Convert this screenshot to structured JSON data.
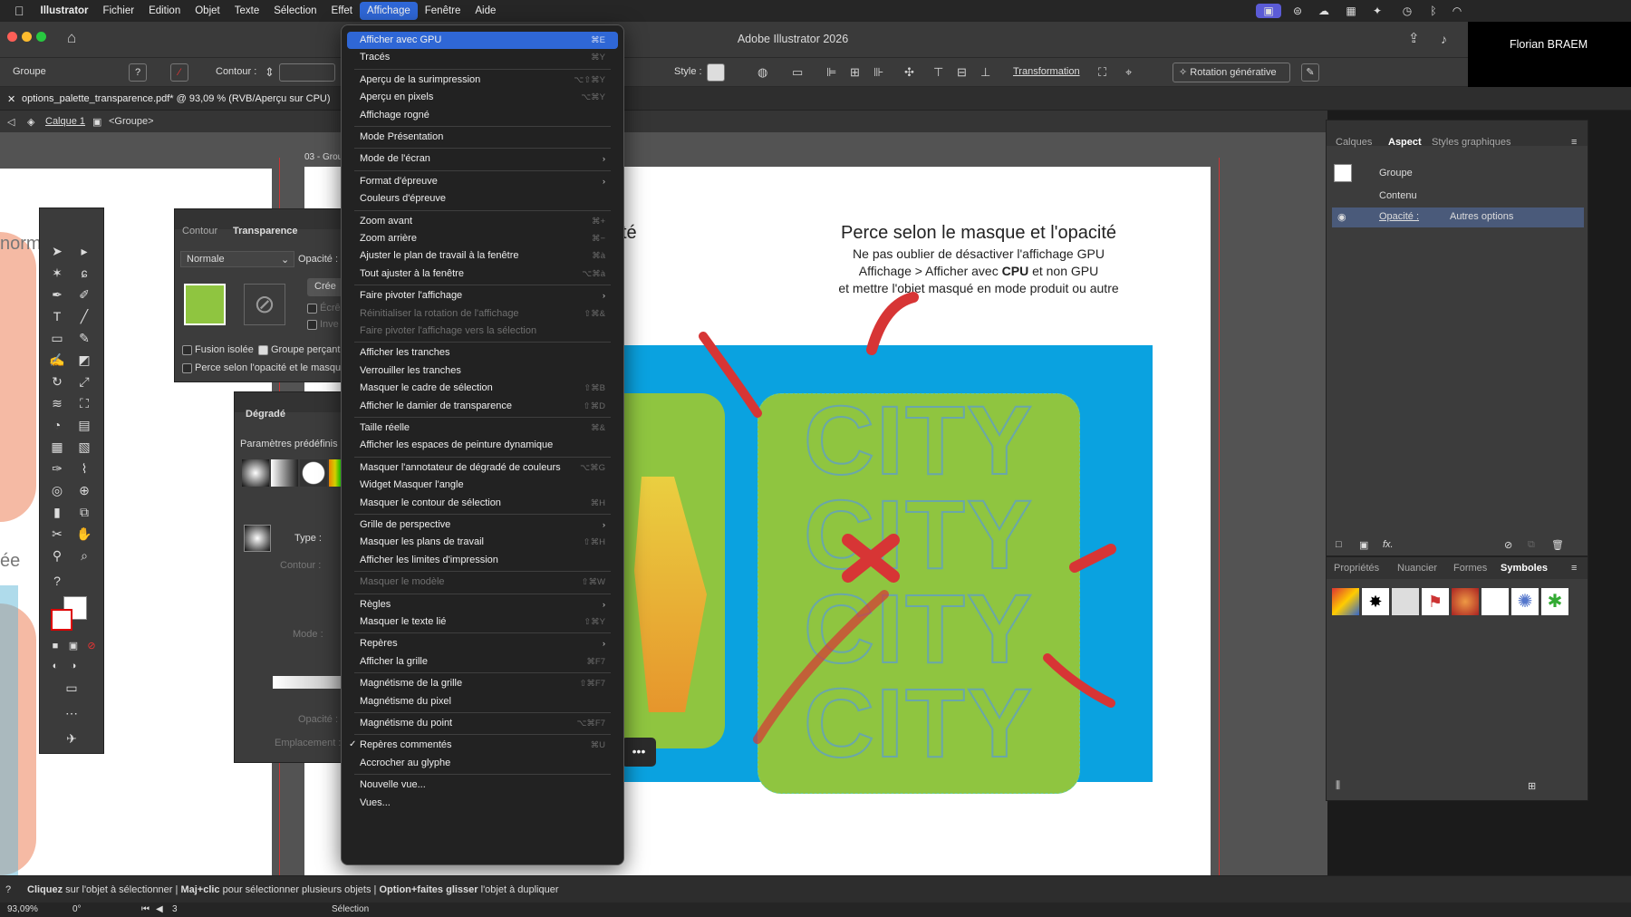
{
  "menubar": {
    "app": "Illustrator",
    "items": [
      "Fichier",
      "Edition",
      "Objet",
      "Texte",
      "Sélection",
      "Effet",
      "Affichage",
      "Fenêtre",
      "Aide"
    ],
    "active": "Affichage"
  },
  "window": {
    "title": "Adobe Illustrator 2026",
    "user": "Florian BRAEM"
  },
  "control": {
    "selection": "Groupe",
    "stroke_label": "Contour :",
    "style_label": "Style :",
    "transform": "Transformation",
    "generative": "Rotation générative"
  },
  "document": {
    "tab": "options_palette_transparence.pdf* @ 93,09 % (RVB/Aperçu sur CPU)",
    "layer": "Calque 1",
    "group": "<Groupe>",
    "artboard_label": "03 - Grou"
  },
  "artwork": {
    "heading": "Perce selon le masque et l'opacité",
    "line1": "Ne pas oublier de désactiver l'affichage GPU",
    "line2_a": "Affichage > Afficher avec ",
    "line2_b": "CPU",
    "line2_c": " et non GPU",
    "line3": "et mettre l'objet masqué en mode produit ou autre",
    "left_partial": "té",
    "word": "CITY",
    "colors": {
      "blue": "#0aa2e0",
      "green": "#8fc540",
      "red": "#d73535"
    }
  },
  "left_text": {
    "a": "norm",
    "b": "ée"
  },
  "transparency": {
    "tab1": "Contour",
    "tab2": "Transparence",
    "blend": "Normale",
    "opacity_label": "Opacité :",
    "create": "Crée",
    "clip": "Écrê",
    "invert": "Inve",
    "isolate": "Fusion isolée",
    "knockout": "Groupe perçant",
    "knockout_opacity": "Perce selon l'opacité et le masqu"
  },
  "gradient": {
    "title": "Dégradé",
    "presets": "Paramètres prédéfinis :",
    "type": "Type :",
    "stroke": "Contour :",
    "mode": "Mode :",
    "opacity": "Opacité :",
    "location": "Emplacement :"
  },
  "appearance": {
    "tabs": [
      "Calques",
      "Aspect",
      "Styles graphiques"
    ],
    "active": "Aspect",
    "group": "Groupe",
    "content": "Contenu",
    "opacity": "Opacité :",
    "other": "Autres options"
  },
  "symbols": {
    "tabs": [
      "Propriétés",
      "Nuancier",
      "Formes",
      "Symboles"
    ],
    "active": "Symboles"
  },
  "menu": [
    {
      "label": "Afficher avec GPU",
      "key": "⌘E",
      "hl": true
    },
    {
      "label": "Tracés",
      "key": "⌘Y"
    },
    {
      "sep": true
    },
    {
      "label": "Aperçu de la surimpression",
      "key": "⌥⇧⌘Y"
    },
    {
      "label": "Aperçu en pixels",
      "key": "⌥⌘Y"
    },
    {
      "label": "Affichage rogné"
    },
    {
      "sep": true
    },
    {
      "label": "Mode Présentation"
    },
    {
      "sep": true
    },
    {
      "label": "Mode de l'écran",
      "sub": true
    },
    {
      "sep": true
    },
    {
      "label": "Format d'épreuve",
      "sub": true
    },
    {
      "label": "Couleurs d'épreuve"
    },
    {
      "sep": true
    },
    {
      "label": "Zoom avant",
      "key": "⌘+"
    },
    {
      "label": "Zoom arrière",
      "key": "⌘−"
    },
    {
      "label": "Ajuster le plan de travail à la fenêtre",
      "key": "⌘à"
    },
    {
      "label": "Tout ajuster à la fenêtre",
      "key": "⌥⌘à"
    },
    {
      "sep": true
    },
    {
      "label": "Faire pivoter l'affichage",
      "sub": true
    },
    {
      "label": "Réinitialiser la rotation de l'affichage",
      "key": "⇧⌘&",
      "dis": true
    },
    {
      "label": "Faire pivoter l'affichage vers la sélection",
      "dis": true
    },
    {
      "sep": true
    },
    {
      "label": "Afficher les tranches"
    },
    {
      "label": "Verrouiller les tranches"
    },
    {
      "label": "Masquer le cadre de sélection",
      "key": "⇧⌘B"
    },
    {
      "label": "Afficher le damier de transparence",
      "key": "⇧⌘D"
    },
    {
      "sep": true
    },
    {
      "label": "Taille réelle",
      "key": "⌘&"
    },
    {
      "label": "Afficher les espaces de peinture dynamique"
    },
    {
      "sep": true
    },
    {
      "label": "Masquer l'annotateur de dégradé de couleurs",
      "key": "⌥⌘G"
    },
    {
      "label": "Widget Masquer l'angle"
    },
    {
      "label": "Masquer le contour de sélection",
      "key": "⌘H"
    },
    {
      "sep": true
    },
    {
      "label": "Grille de perspective",
      "sub": true
    },
    {
      "label": "Masquer les plans de travail",
      "key": "⇧⌘H"
    },
    {
      "label": "Afficher les limites d'impression"
    },
    {
      "sep": true
    },
    {
      "label": "Masquer le modèle",
      "key": "⇧⌘W",
      "dis": true
    },
    {
      "sep": true
    },
    {
      "label": "Règles",
      "sub": true
    },
    {
      "label": "Masquer le texte lié",
      "key": "⇧⌘Y"
    },
    {
      "sep": true
    },
    {
      "label": "Repères",
      "sub": true
    },
    {
      "label": "Afficher la grille",
      "key": "⌘F7"
    },
    {
      "sep": true
    },
    {
      "label": "Magnétisme de la grille",
      "key": "⇧⌘F7"
    },
    {
      "label": "Magnétisme du pixel"
    },
    {
      "sep": true
    },
    {
      "label": "Magnétisme du point",
      "key": "⌥⌘F7"
    },
    {
      "sep": true
    },
    {
      "label": "Repères commentés",
      "key": "⌘U",
      "check": true
    },
    {
      "label": "Accrocher au glyphe"
    },
    {
      "sep": true
    },
    {
      "label": "Nouvelle vue..."
    },
    {
      "label": "Vues..."
    }
  ],
  "status": {
    "a1": "Cliquez",
    "a2": " sur l'objet à sélectionner  |  ",
    "b1": "Maj+clic",
    "b2": " pour sélectionner plusieurs objets  |  ",
    "c1": "Option+faites glisser",
    "c2": " l'objet à dupliquer"
  },
  "bottom": {
    "zoom": "93,09%",
    "angle": "0°",
    "page": "3",
    "tool": "Sélection"
  }
}
